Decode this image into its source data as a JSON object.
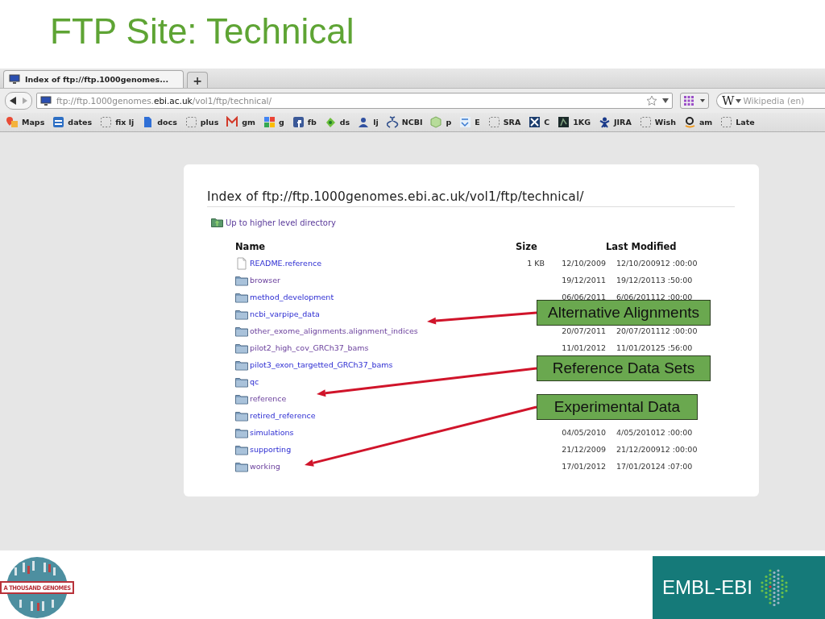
{
  "slide": {
    "title": "FTP Site: Technical"
  },
  "browser": {
    "tabs": [
      {
        "title": "Index of ftp://ftp.1000genomes...",
        "selected": true
      }
    ],
    "new_tab": "+",
    "address": "ftp://ftp.1000genomes.**ebi.ac.uk**/vol1/ftp/technical/",
    "search": {
      "engine": "W",
      "placeholder": "Wikipedia (en)"
    },
    "bookmarks": [
      "Maps",
      "dates",
      "fix lj",
      "docs",
      "plus",
      "gm",
      "g",
      "fb",
      "ds",
      "lj",
      "NCBI",
      "p",
      "E",
      "SRA",
      "C",
      "1KG",
      "JIRA",
      "Wish",
      "am",
      "Late"
    ]
  },
  "listing": {
    "heading": "Index of ftp://ftp.1000genomes.ebi.ac.uk/vol1/ftp/technical/",
    "up_link": "Up to higher level directory",
    "columns": [
      "Name",
      "Size",
      "Last Modified"
    ],
    "rows": [
      {
        "name": "README.reference",
        "kind": "file",
        "visited": false,
        "size": "1 KB",
        "date": "12/10/2009",
        "modified": "12/10/200912 :00:00"
      },
      {
        "name": "browser",
        "kind": "folder",
        "visited": true,
        "date": "19/12/2011",
        "modified": "19/12/20113 :50:00"
      },
      {
        "name": "method_development",
        "kind": "folder",
        "visited": false,
        "date": "06/06/2011",
        "modified": "6/06/201112 :00:00"
      },
      {
        "name": "ncbi_varpipe_data",
        "kind": "folder",
        "visited": false
      },
      {
        "name": "other_exome_alignments.alignment_indices",
        "kind": "folder",
        "visited": true,
        "date": "20/07/2011",
        "modified": "20/07/201112 :00:00"
      },
      {
        "name": "pilot2_high_cov_GRCh37_bams",
        "kind": "folder",
        "visited": true,
        "date": "11/01/2012",
        "modified": "11/01/20125 :56:00"
      },
      {
        "name": "pilot3_exon_targetted_GRCh37_bams",
        "kind": "folder",
        "visited": false
      },
      {
        "name": "qc",
        "kind": "folder",
        "visited": false
      },
      {
        "name": "reference",
        "kind": "folder",
        "visited": true
      },
      {
        "name": "retired_reference",
        "kind": "folder",
        "visited": false
      },
      {
        "name": "simulations",
        "kind": "folder",
        "visited": false,
        "date": "04/05/2010",
        "modified": "4/05/201012 :00:00"
      },
      {
        "name": "supporting",
        "kind": "folder",
        "visited": false,
        "date": "21/12/2009",
        "modified": "21/12/200912 :00:00"
      },
      {
        "name": "working",
        "kind": "folder",
        "visited": true,
        "date": "17/01/2012",
        "modified": "17/01/20124 :07:00"
      }
    ]
  },
  "callouts": [
    {
      "text": "Alternative Alignments"
    },
    {
      "text": "Reference Data Sets"
    },
    {
      "text": "Experimental Data"
    }
  ],
  "footer": {
    "left_logo": "A THOUSAND GENOMES",
    "right_logo": "EMBL-EBI"
  }
}
